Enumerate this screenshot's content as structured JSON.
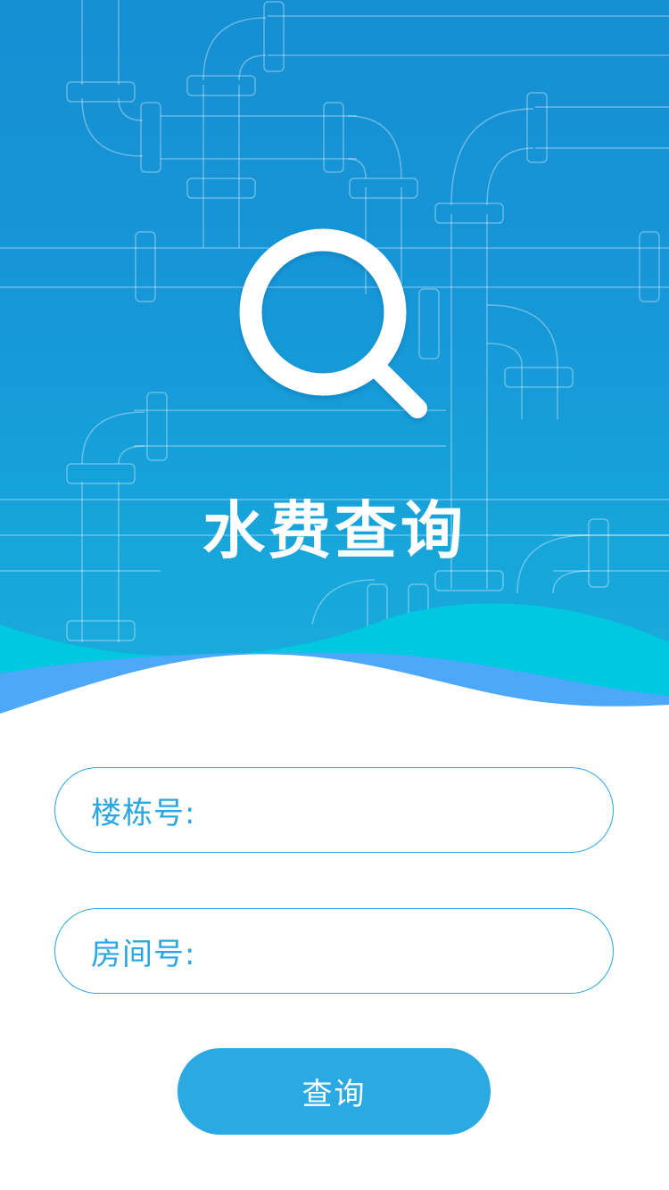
{
  "header": {
    "title": "水费查询",
    "icon": "magnifier-icon"
  },
  "form": {
    "building_label": "楼栋号:",
    "building_value": "",
    "room_label": "房间号:",
    "room_value": "",
    "submit_label": "查询"
  },
  "colors": {
    "hero_top": "#168fd3",
    "hero_bottom": "#18aedc",
    "wave_cyan": "#00c8df",
    "wave_blue": "#4da8fa",
    "accent": "#2aa6e0",
    "button": "#2aa9e3"
  }
}
